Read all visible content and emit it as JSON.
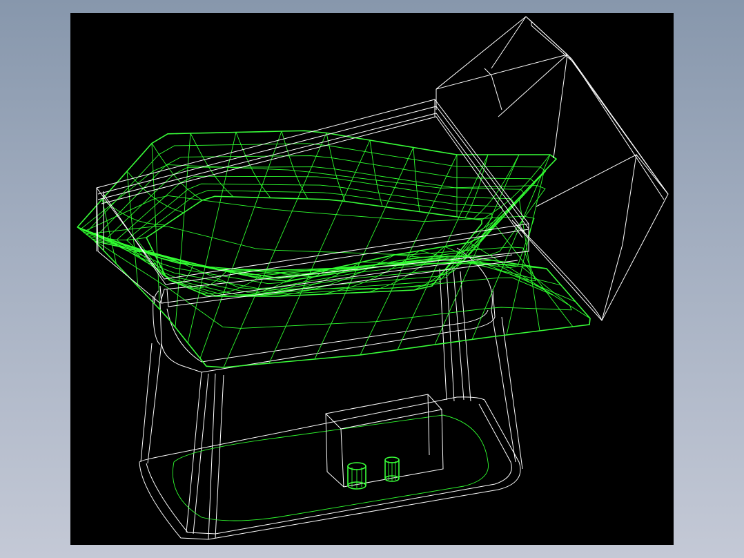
{
  "viewport": {
    "background": "#000000",
    "wire_color_white": "#ffffff",
    "wire_color_green": "#2fff2f"
  },
  "model": {
    "parts": [
      "hopper-box",
      "tray-frame",
      "curved-tray-surface",
      "base-stand",
      "control-box",
      "knob-left",
      "knob-right",
      "base-inner-groove"
    ]
  }
}
